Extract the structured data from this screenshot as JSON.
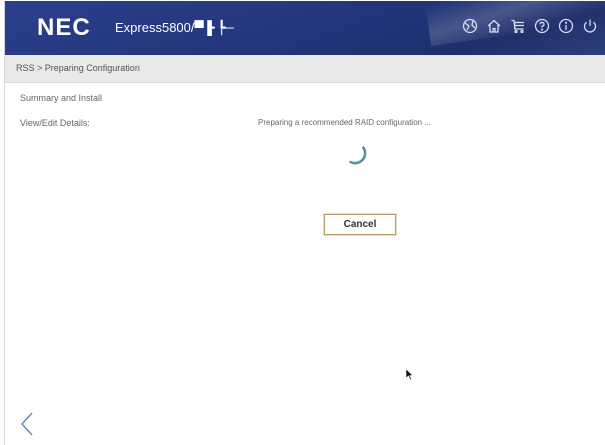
{
  "header": {
    "logo": "NEC",
    "product": "Express5800/",
    "product_obscured": "▀▐╸┡─",
    "icons": [
      "globe-icon",
      "home-icon",
      "cart-icon",
      "help-icon",
      "info-icon",
      "power-icon"
    ]
  },
  "breadcrumb": "RSS > Preparing Configuration",
  "nav": {
    "summary": "Summary and Install",
    "view_edit": "View/Edit Details:"
  },
  "main": {
    "status": "Preparing a recommended RAID configuration ...",
    "cancel_label": "Cancel"
  },
  "colors": {
    "header_bg": "#22357a",
    "spinner": "#5a8ea8",
    "button_border": "#b99b6b"
  }
}
